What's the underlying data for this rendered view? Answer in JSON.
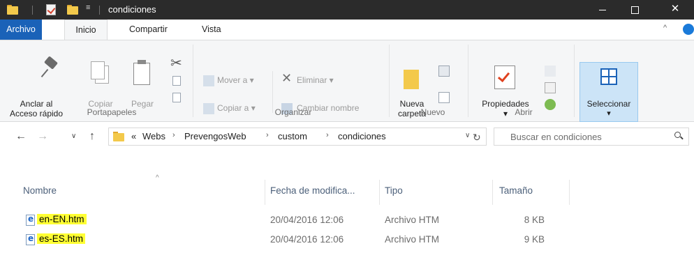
{
  "window": {
    "title": "condiciones",
    "quick_access_arrow": "≡",
    "minimize": "",
    "maximize": "",
    "close": "✕"
  },
  "ribbon_tabs": [
    "Archivo",
    "Inicio",
    "Compartir",
    "Vista"
  ],
  "ribbon_collapse": "^",
  "ribbon": {
    "portapapeles": {
      "label": "Portapapeles",
      "anclar_line1": "Anclar al",
      "anclar_line2": "Acceso rápido",
      "copiar": "Copiar",
      "pegar": "Pegar"
    },
    "organizar": {
      "label": "Organizar",
      "mover": "Mover a ▾",
      "copiar": "Copiar a ▾",
      "eliminar": "Eliminar ▾",
      "cambiar": "Cambiar nombre"
    },
    "nuevo": {
      "label": "Nuevo",
      "nueva_line1": "Nueva",
      "nueva_line2": "carpeta"
    },
    "abrir": {
      "label": "Abrir",
      "propiedades": "Propiedades",
      "prop_arrow": "▾"
    },
    "seleccionar": {
      "label": "Seleccionar",
      "arrow": "▾"
    }
  },
  "nav": {
    "back": "←",
    "forward": "→",
    "recent": "∨",
    "up": "↑"
  },
  "address": {
    "overflow": "«",
    "crumbs": [
      "Webs",
      "PrevengosWeb",
      "custom",
      "condiciones"
    ],
    "separator": "›",
    "dropdown": "∨",
    "refresh": "↻"
  },
  "search": {
    "placeholder": "Buscar en condiciones"
  },
  "columns": {
    "sort_indicator": "^",
    "name": "Nombre",
    "date": "Fecha de modifica...",
    "type": "Tipo",
    "size": "Tamaño"
  },
  "files": [
    {
      "name": "en-EN.htm",
      "date": "20/04/2016 12:06",
      "type": "Archivo HTM",
      "size": "8 KB"
    },
    {
      "name": "es-ES.htm",
      "date": "20/04/2016 12:06",
      "type": "Archivo HTM",
      "size": "9 KB"
    }
  ]
}
